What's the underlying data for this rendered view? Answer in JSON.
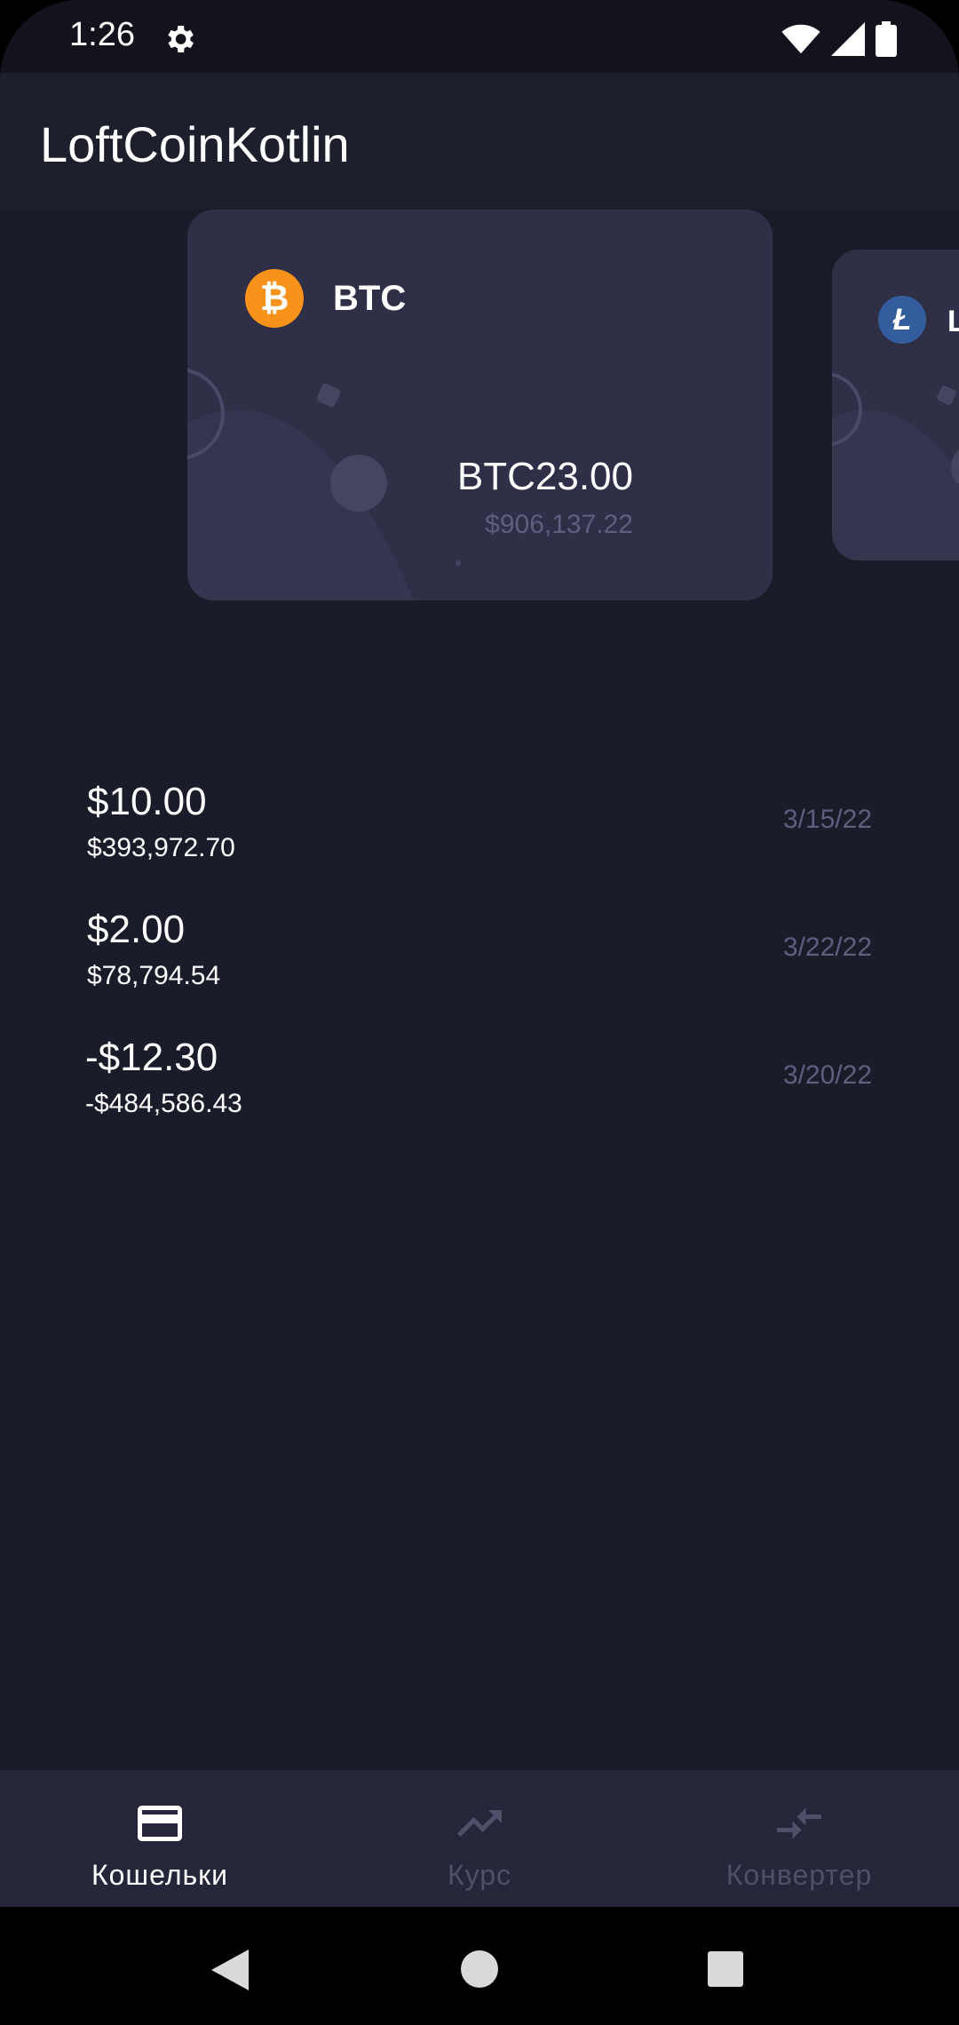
{
  "status_bar": {
    "time": "1:26",
    "icons": [
      "gear-icon",
      "wifi-icon",
      "signal-icon",
      "battery-icon"
    ]
  },
  "app_bar": {
    "title": "LoftCoinKotlin"
  },
  "wallet_cards": [
    {
      "symbol": "BTC",
      "balance": "BTC23.00",
      "fiat_balance": "$906,137.22",
      "icon_color": "#f7931a"
    },
    {
      "symbol": "L",
      "icon_color": "#345d9d"
    }
  ],
  "transactions": [
    {
      "amount": "$10.00",
      "fiat": "$393,972.70",
      "date": "3/15/22"
    },
    {
      "amount": "$2.00",
      "fiat": "$78,794.54",
      "date": "3/22/22"
    },
    {
      "amount": "-$12.30",
      "fiat": "-$484,586.43",
      "date": "3/20/22"
    }
  ],
  "bottom_nav": {
    "items": [
      {
        "label": "Кошельки",
        "icon": "wallet-card-icon",
        "active": true
      },
      {
        "label": "Курс",
        "icon": "trending-up-icon",
        "active": false
      },
      {
        "label": "Конвертер",
        "icon": "swap-arrows-icon",
        "active": false
      }
    ]
  },
  "colors": {
    "background": "#1b1c2a",
    "card": "#2f2f48",
    "muted_text": "#5e5e7f",
    "nav_background": "#25263a"
  }
}
